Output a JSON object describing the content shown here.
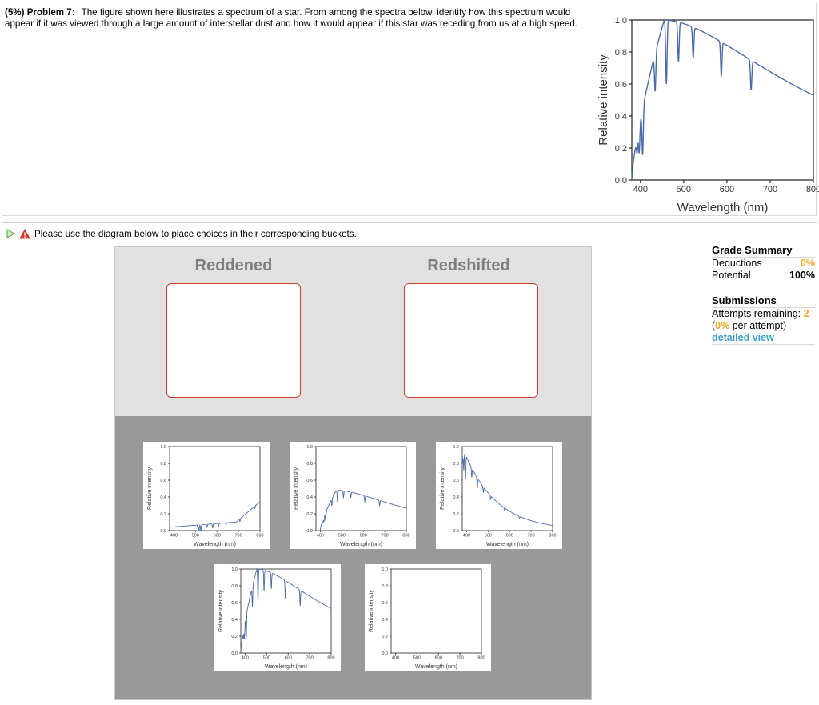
{
  "problem": {
    "title": "(5%) Problem 7:",
    "text": "The figure shown here illustrates a spectrum of a star. From among the spectra below, identify how this spectrum would appear if it was viewed through a large amount of interstellar dust and how it would appear if this star was receding from us at a high speed."
  },
  "main_figure": {
    "ylabel": "Relative intensity",
    "xlabel": "Wavelength (nm)",
    "xticks": [
      "400",
      "500",
      "600",
      "700",
      "800"
    ],
    "yticks": [
      "0.0",
      "0.2",
      "0.4",
      "0.6",
      "0.8",
      "1.0"
    ]
  },
  "instructions": {
    "text": "Please use the diagram below to place choices in their corresponding buckets."
  },
  "buckets": [
    {
      "label": "Reddened"
    },
    {
      "label": "Redshifted"
    }
  ],
  "choice_axis": {
    "ylabel": "Relative intensity",
    "xlabel": "Wavelength (nm)",
    "xticks": [
      "400",
      "500",
      "600",
      "700",
      "800"
    ],
    "yticks": [
      "0.0",
      "0.2",
      "0.4",
      "0.6",
      "0.8",
      "1.0"
    ]
  },
  "choices": [
    {
      "id": "A",
      "trend": "rising-low"
    },
    {
      "id": "B",
      "trend": "peaked-mid"
    },
    {
      "id": "C",
      "trend": "falling"
    },
    {
      "id": "D",
      "trend": "original"
    },
    {
      "id": "E",
      "trend": "rising-linear"
    }
  ],
  "grade_summary": {
    "title": "Grade Summary",
    "deductions_label": "Deductions",
    "deductions_value": "0%",
    "potential_label": "Potential",
    "potential_value": "100%"
  },
  "submissions": {
    "title": "Submissions",
    "attempts_label": "Attempts remaining:",
    "attempts_value": "2",
    "paren_open": "(",
    "per_attempt_value": "0%",
    "per_attempt_label": "per attempt)",
    "detailed_view": "detailed view"
  },
  "colors": {
    "line": "#4a6aa8",
    "bucket_border": "#d23c2c",
    "accent_orange": "#f5a623",
    "link_blue": "#3aa0c8"
  }
}
